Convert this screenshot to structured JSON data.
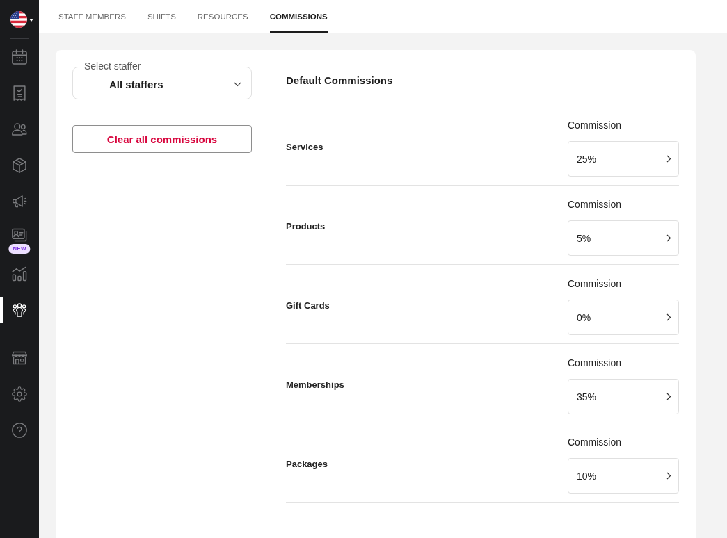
{
  "sidebar": {
    "main_items": [
      {
        "selected": false
      },
      {
        "selected": false
      },
      {
        "selected": false
      },
      {
        "selected": false
      },
      {
        "selected": false
      },
      {
        "selected": false,
        "badge": "NEW"
      },
      {
        "selected": false
      },
      {
        "selected": true
      }
    ],
    "bottom_items": [
      {
        "selected": false
      },
      {
        "selected": false
      },
      {
        "selected": false
      }
    ]
  },
  "tabs": [
    {
      "label": "STAFF MEMBERS",
      "selected": false
    },
    {
      "label": "SHIFTS",
      "selected": false
    },
    {
      "label": "RESOURCES",
      "selected": false
    },
    {
      "label": "COMMISSIONS",
      "selected": true
    }
  ],
  "staffer_select": {
    "label": "Select staffer",
    "value": "All staffers"
  },
  "clear_button": {
    "label": "Clear all commissions"
  },
  "default_commissions": {
    "title": "Default Commissions",
    "rows": [
      {
        "name": "Services",
        "field_label": "Commission",
        "value": "25%"
      },
      {
        "name": "Products",
        "field_label": "Commission",
        "value": "5%"
      },
      {
        "name": "Gift Cards",
        "field_label": "Commission",
        "value": "0%"
      },
      {
        "name": "Memberships",
        "field_label": "Commission",
        "value": "35%"
      },
      {
        "name": "Packages",
        "field_label": "Commission",
        "value": "10%"
      }
    ]
  }
}
